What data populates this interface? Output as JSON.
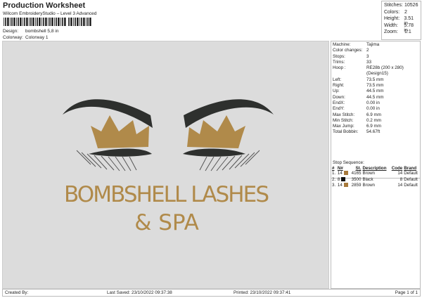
{
  "header": {
    "title": "Production Worksheet",
    "subtitle": "Wilcom EmbroideryStudio – Level 3 Advanced",
    "design_label": "Design:",
    "design_value": "bombshell 5,8 in",
    "colorway_label": "Colorway:",
    "colorway_value": "Colorway 1"
  },
  "stats": [
    {
      "k": "Stitches:",
      "v": "10526"
    },
    {
      "k": "Colors:",
      "v": "2"
    },
    {
      "k": "Height:",
      "v": "3.51 in"
    },
    {
      "k": "Width:",
      "v": "5.78 in"
    },
    {
      "k": "Zoom:",
      "v": "1:1"
    }
  ],
  "info": [
    {
      "k": "Machine:",
      "v": "Tajima"
    },
    {
      "k": "Color changes:",
      "v": "2"
    },
    {
      "k": "Stops:",
      "v": "3"
    },
    {
      "k": "Trims:",
      "v": "33"
    },
    {
      "k": "Hoop :",
      "v": "RE28b (200 x 280)"
    },
    {
      "k": "",
      "v": "(Design15)"
    },
    {
      "k": "Left:",
      "v": "73.5 mm"
    },
    {
      "k": "Right:",
      "v": "73.5 mm"
    },
    {
      "k": "Up:",
      "v": "44.5 mm"
    },
    {
      "k": "Down:",
      "v": "44.5 mm"
    },
    {
      "k": "EndX:",
      "v": "0.00 in"
    },
    {
      "k": "EndY:",
      "v": "0.00 in"
    },
    {
      "k": "Max Stitch:",
      "v": "6.9 mm"
    },
    {
      "k": "Min Stitch:",
      "v": "0.2 mm"
    },
    {
      "k": "Max Jump:",
      "v": "6.9 mm"
    },
    {
      "k": "Total Bobbin:",
      "v": "54.67ft"
    }
  ],
  "sequence": {
    "title": "Stop Sequence:",
    "headers": [
      "#",
      "N#",
      "St.",
      "Description",
      "Code",
      "Brand"
    ],
    "rows": [
      {
        "i": "1.",
        "n": "14",
        "color": "#a87a3c",
        "st": "4165",
        "desc": "Brown",
        "code": "14",
        "brand": "Default"
      },
      {
        "i": "2.",
        "n": "8",
        "color": "#111111",
        "st": "3500",
        "desc": "Black",
        "code": "8",
        "brand": "Default"
      },
      {
        "i": "3.",
        "n": "14",
        "color": "#a87a3c",
        "st": "2859",
        "desc": "Brown",
        "code": "14",
        "brand": "Default"
      }
    ]
  },
  "design": {
    "line1": "BOMBSHELL LASHES",
    "line2": "& SPA",
    "gold": "#b08a4a",
    "black": "#2e302e"
  },
  "footer": {
    "created": "Created By:",
    "saved": "Last Saved: 23/10/2022 09:37:38",
    "printed": "Printed: 23/10/2022 09:37:41",
    "page": "Page 1 of 1"
  }
}
